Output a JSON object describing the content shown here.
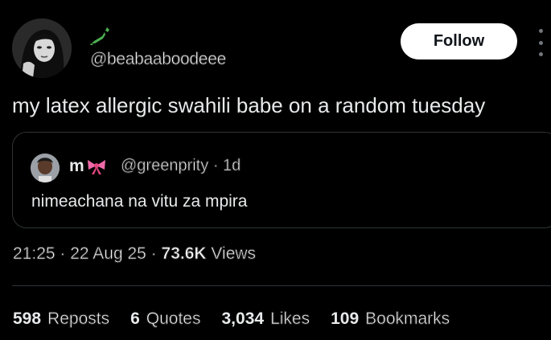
{
  "author": {
    "handle": "@beabaaboodeee",
    "name_icon": "japan-map-emoji"
  },
  "follow_label": "Follow",
  "post_text": "my latex allergic swahili babe on a random tuesday",
  "quote": {
    "name": "m",
    "name_emoji": "ribbon-bow-emoji",
    "handle": "@greenprity",
    "time": "· 1d",
    "text": "nimeachana na vitu za mpira"
  },
  "meta": {
    "time": "21:25",
    "date": "22 Aug 25",
    "views_count": "73.6K",
    "views_label": "Views",
    "separator": "·"
  },
  "stats": [
    {
      "count": "598",
      "label": "Reposts"
    },
    {
      "count": "6",
      "label": "Quotes"
    },
    {
      "count": "3,034",
      "label": "Likes"
    },
    {
      "count": "109",
      "label": "Bookmarks"
    }
  ],
  "colors": {
    "background": "#000000",
    "text": "#e7e9ea",
    "secondary": "#71767b",
    "border": "#2f3336",
    "follow_bg": "#ffffff",
    "follow_text": "#0f1419"
  }
}
